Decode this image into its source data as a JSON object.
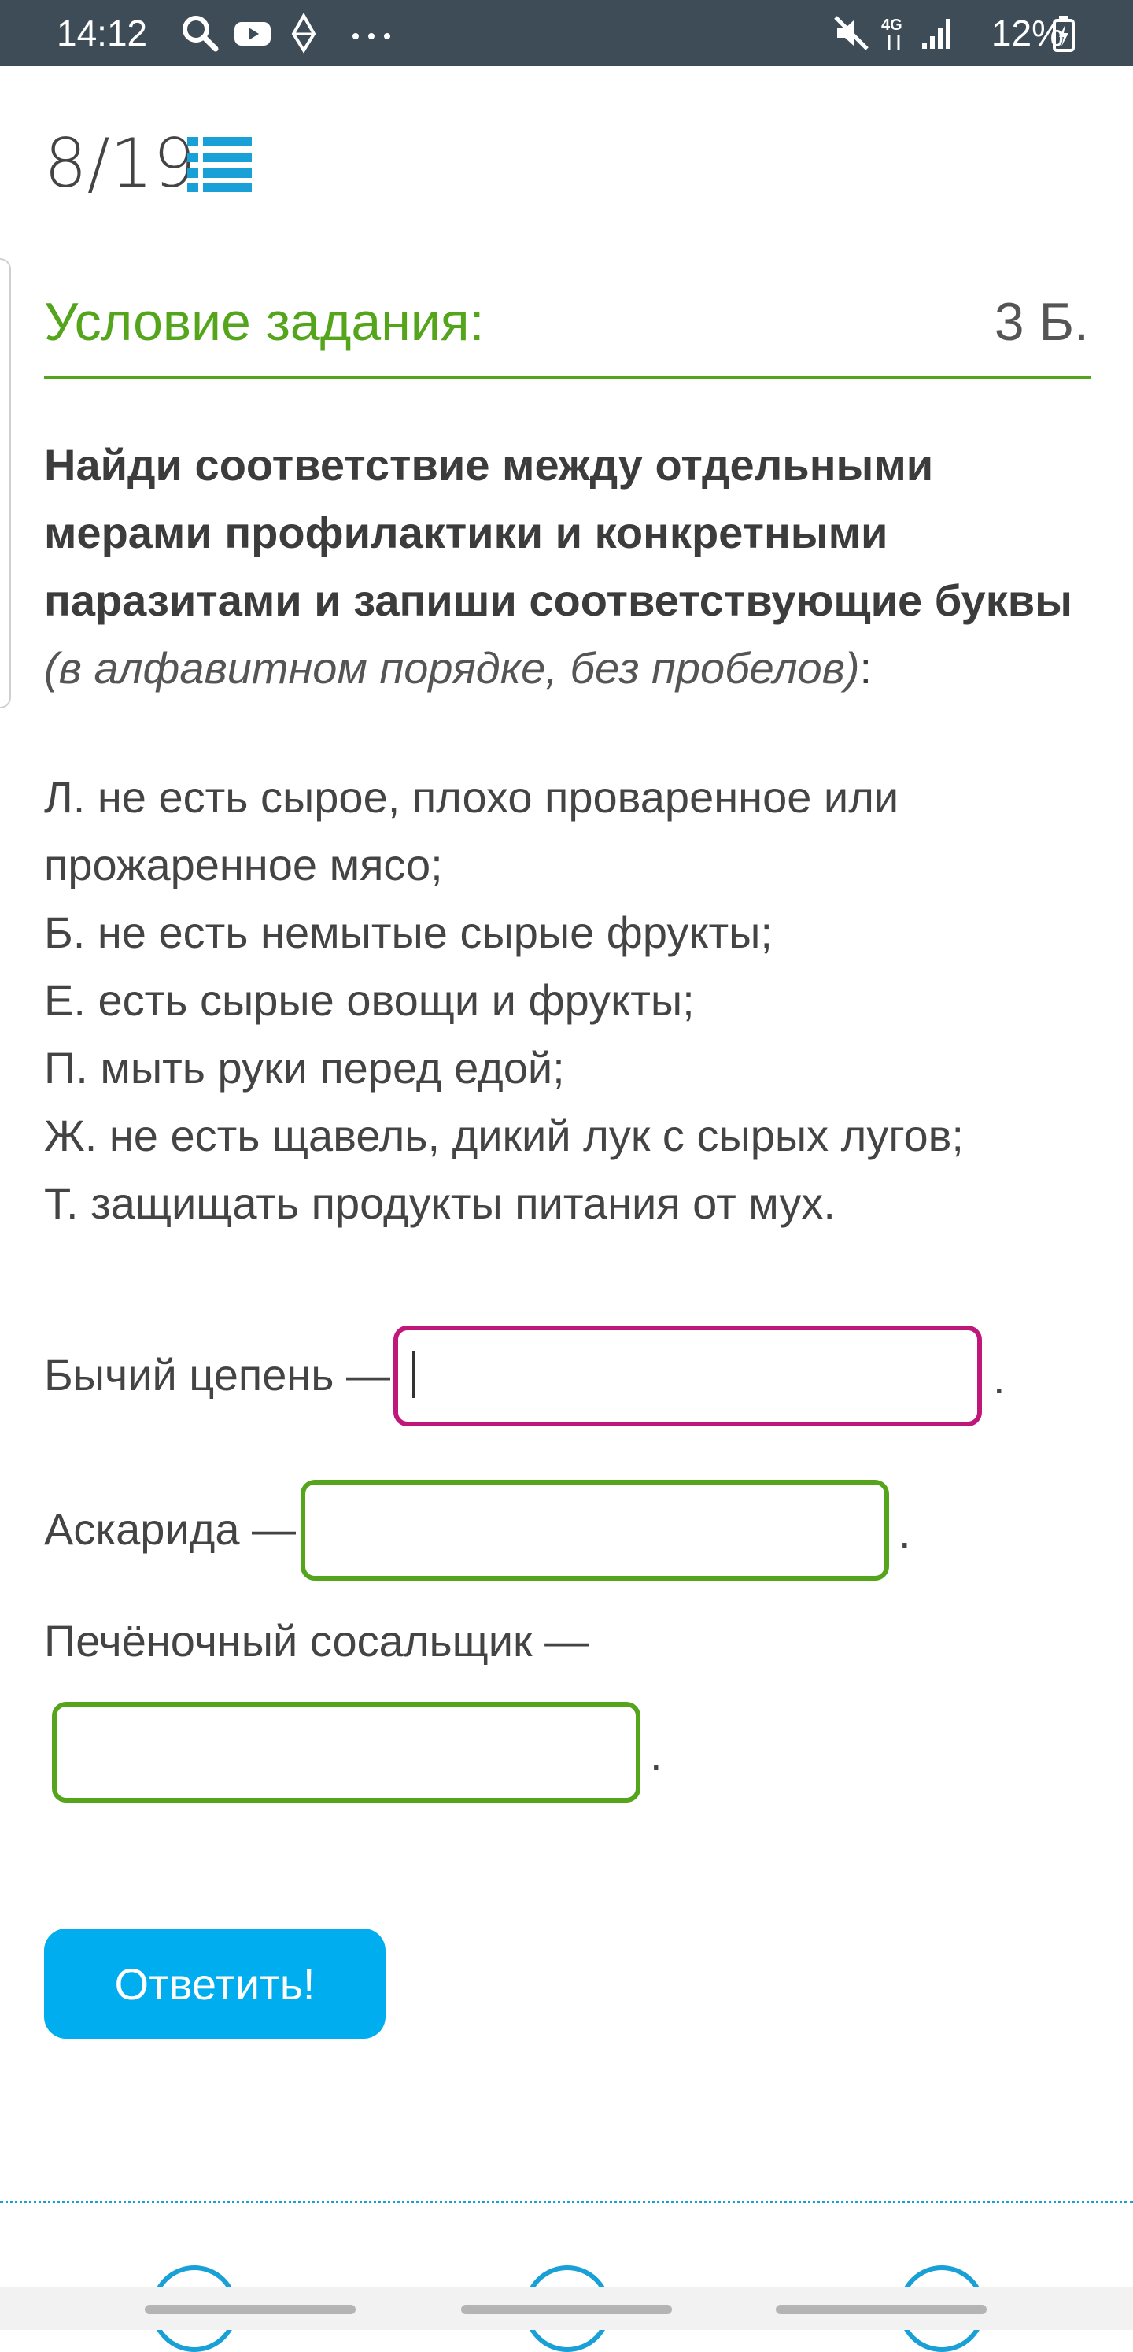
{
  "status_bar": {
    "time": "14:12",
    "battery": "12%",
    "icons": [
      "search-icon",
      "youtube-icon",
      "diamond-icon",
      "more-icon",
      "mute-icon",
      "network-4g-icon",
      "signal-icon",
      "battery-charging-icon"
    ],
    "network_label": "4G"
  },
  "header": {
    "page_counter": "8/19",
    "list_icon": "list-icon"
  },
  "task": {
    "title": "Условие задания:",
    "points": "3 Б.",
    "question_bold": "Найди соответствие между отдельными мерами профилактики и конкретными паразитами и запиши соответствующие буквы",
    "question_italic": "(в алфавитном порядке, без пробелов)",
    "question_end": ":",
    "options": [
      "Л. не есть сырое, плохо проваренное или",
      "прожаренное мясо;",
      "Б. не есть немытые сырые фрукты;",
      "Е. есть сырые овощи и фрукты;",
      "П. мыть руки перед едой;",
      "Ж. не есть щавель, дикий лук с сырых лугов;",
      "Т. защищать продукты питания от мух."
    ]
  },
  "answers": [
    {
      "label": "Бычий цепень —",
      "value": "",
      "suffix": "."
    },
    {
      "label": "Аскарида —",
      "value": "",
      "suffix": "."
    },
    {
      "label": "Печёночный сосальщик —",
      "value": "",
      "suffix": "."
    }
  ],
  "submit_label": "Ответить!",
  "colors": {
    "accent_green": "#54a51c",
    "active_input_border": "#c0177a",
    "button_blue": "#00aeef",
    "status_bar_bg": "#3d4c57"
  }
}
